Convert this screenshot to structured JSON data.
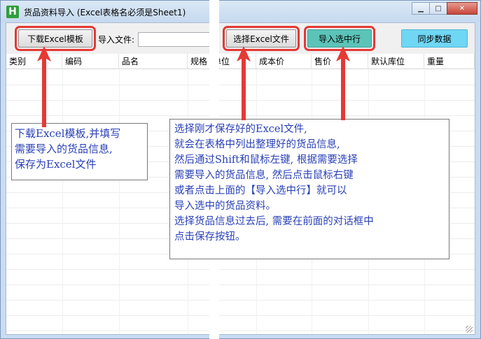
{
  "window": {
    "app_icon_letter": "H",
    "title": "货品资料导入 (Excel表格名必须是Sheet1)",
    "minimize_glyph": "▁",
    "maximize_glyph": "□",
    "close_glyph": "✕"
  },
  "toolbar": {
    "download_template_label": "下载Excel模板",
    "import_file_label": "导入文件:",
    "import_file_value": "",
    "select_excel_label": "选择Excel文件",
    "import_selected_label": "导入选中行",
    "sync_data_label": "同步数据"
  },
  "colors": {
    "import_selected_bg": "#5cc3b8",
    "sync_data_bg": "#6fd6f4",
    "highlight_border": "#e53935",
    "note_text": "#2a41b6"
  },
  "grid": {
    "columns": [
      "类别",
      "编码",
      "品名",
      "规格",
      "单位",
      "成本价",
      "售价",
      "默认库位",
      "重量"
    ],
    "rows": []
  },
  "notes": {
    "left": [
      "下载Excel模板,并填写",
      "需要导入的货品信息,",
      "保存为Excel文件"
    ],
    "right": [
      "选择刚才保存好的Excel文件,",
      "就会在表格中列出整理好的货品信息,",
      "然后通过Shift和鼠标左键, 根据需要选择",
      "需要导入的货品信息, 然后点击鼠标右键",
      "或者点击上面的【导入选中行】就可以",
      "导入选中的货品资料。",
      "选择货品信息过去后, 需要在前面的对话框中",
      "点击保存按钮。"
    ]
  }
}
